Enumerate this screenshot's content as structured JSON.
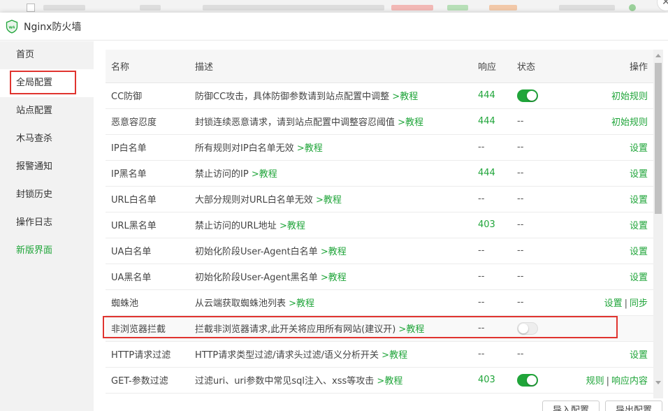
{
  "window": {
    "title": "Nginx防火墙"
  },
  "sidebar": {
    "items": [
      {
        "label": "首页"
      },
      {
        "label": "全局配置"
      },
      {
        "label": "站点配置"
      },
      {
        "label": "木马查杀"
      },
      {
        "label": "报警通知"
      },
      {
        "label": "封锁历史"
      },
      {
        "label": "操作日志"
      },
      {
        "label": "新版界面"
      }
    ]
  },
  "table": {
    "headers": {
      "name": "名称",
      "desc": "描述",
      "response": "响应",
      "status": "状态",
      "ops": "操作"
    },
    "rows": [
      {
        "name": "CC防御",
        "desc": "防御CC攻击，具体防御参数请到站点配置中调整",
        "tutorial": ">教程",
        "response": "444",
        "status": "on",
        "status_text": "",
        "ops": [
          "初始规则"
        ]
      },
      {
        "name": "恶意容忍度",
        "desc": "封锁连续恶意请求，请到站点配置中调整容忍阈值",
        "tutorial": ">教程",
        "response": "444",
        "status": "none",
        "status_text": "--",
        "ops": [
          "初始规则"
        ]
      },
      {
        "name": "IP白名单",
        "desc": "所有规则对IP白名单无效",
        "tutorial": ">教程",
        "response": "--",
        "status": "none",
        "status_text": "--",
        "ops": [
          "设置"
        ]
      },
      {
        "name": "IP黑名单",
        "desc": "禁止访问的IP",
        "tutorial": ">教程",
        "response": "444",
        "status": "none",
        "status_text": "--",
        "ops": [
          "设置"
        ]
      },
      {
        "name": "URL白名单",
        "desc": "大部分规则对URL白名单无效",
        "tutorial": ">教程",
        "response": "--",
        "status": "none",
        "status_text": "--",
        "ops": [
          "设置"
        ]
      },
      {
        "name": "URL黑名单",
        "desc": "禁止访问的URL地址",
        "tutorial": ">教程",
        "response": "403",
        "status": "none",
        "status_text": "--",
        "ops": [
          "设置"
        ]
      },
      {
        "name": "UA白名单",
        "desc": "初始化阶段User-Agent白名单",
        "tutorial": ">教程",
        "response": "--",
        "status": "none",
        "status_text": "--",
        "ops": [
          "设置"
        ]
      },
      {
        "name": "UA黑名单",
        "desc": "初始化阶段User-Agent黑名单",
        "tutorial": ">教程",
        "response": "--",
        "status": "none",
        "status_text": "--",
        "ops": [
          "设置"
        ]
      },
      {
        "name": "蜘蛛池",
        "desc": "从云端获取蜘蛛池列表",
        "tutorial": ">教程",
        "response": "--",
        "status": "none",
        "status_text": "--",
        "ops": [
          "设置",
          "同步"
        ]
      },
      {
        "name": "非浏览器拦截",
        "desc": "拦截非浏览器请求,此开关将应用所有网站(建议开)",
        "tutorial": ">教程",
        "response": "--",
        "status": "off",
        "status_text": "",
        "ops": []
      },
      {
        "name": "HTTP请求过滤",
        "desc": "HTTP请求类型过滤/请求头过滤/语义分析开关",
        "tutorial": ">教程",
        "response": "--",
        "status": "none",
        "status_text": "--",
        "ops": [
          "设置"
        ]
      },
      {
        "name": "GET-参数过滤",
        "desc": "过滤uri、uri参数中常见sql注入、xss等攻击",
        "tutorial": ">教程",
        "response": "403",
        "status": "on",
        "status_text": "",
        "ops": [
          "规则",
          "响应内容"
        ]
      }
    ]
  },
  "footer": {
    "import_label": "导入配置",
    "export_label": "导出配置"
  },
  "colors": {
    "accent": "#20a53a",
    "highlight": "#e0342f"
  }
}
